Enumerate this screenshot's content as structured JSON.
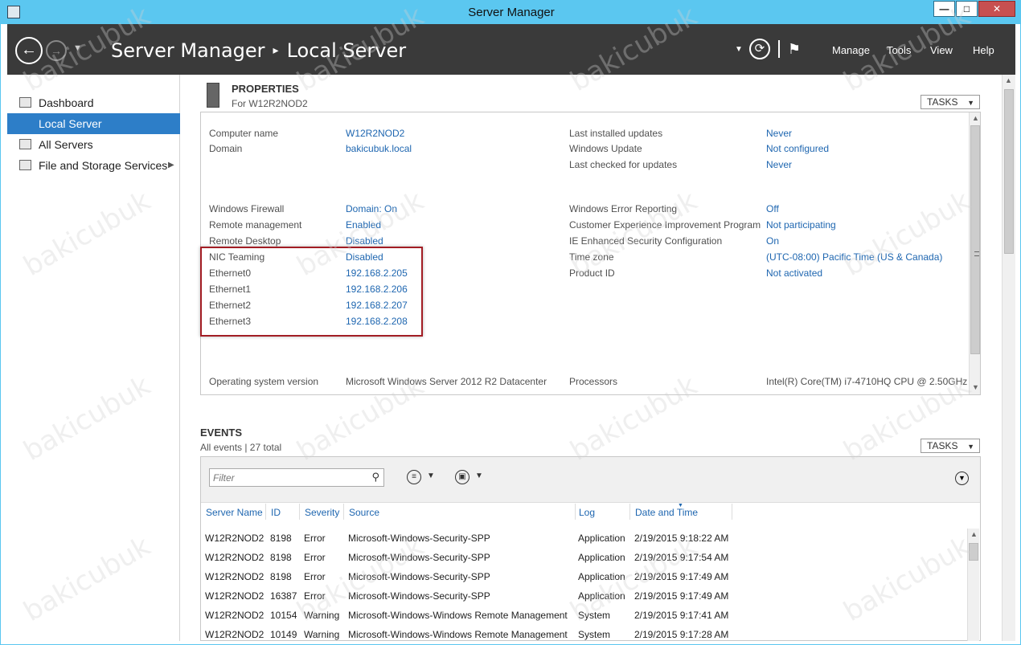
{
  "window": {
    "title": "Server Manager",
    "controls": {
      "minimize": "—",
      "maximize": "□",
      "close": "✕"
    }
  },
  "header": {
    "app": "Server Manager",
    "separator": "▸",
    "page": "Local Server",
    "menus": [
      "Manage",
      "Tools",
      "View",
      "Help"
    ]
  },
  "sidebar": {
    "items": [
      {
        "label": "Dashboard",
        "icon": "dashboard-icon",
        "active": false
      },
      {
        "label": "Local Server",
        "icon": "server-icon",
        "active": true
      },
      {
        "label": "All Servers",
        "icon": "servers-icon",
        "active": false
      },
      {
        "label": "File and Storage Services",
        "icon": "storage-icon",
        "active": false,
        "has_chevron": true
      }
    ]
  },
  "properties": {
    "title": "PROPERTIES",
    "subtitle": "For W12R2NOD2",
    "tasks": "TASKS",
    "left": [
      {
        "label": "Computer name",
        "value": "W12R2NOD2"
      },
      {
        "label": "Domain",
        "value": "bakicubuk.local"
      },
      {
        "label": "Windows Firewall",
        "value": "Domain: On"
      },
      {
        "label": "Remote management",
        "value": "Enabled"
      },
      {
        "label": "Remote Desktop",
        "value": "Disabled"
      },
      {
        "label": "NIC Teaming",
        "value": "Disabled"
      },
      {
        "label": "Ethernet0",
        "value": "192.168.2.205"
      },
      {
        "label": "Ethernet1",
        "value": "192.168.2.206"
      },
      {
        "label": "Ethernet2",
        "value": "192.168.2.207"
      },
      {
        "label": "Ethernet3",
        "value": "192.168.2.208"
      },
      {
        "label": "Operating system version",
        "value": "Microsoft Windows Server 2012 R2 Datacenter"
      }
    ],
    "right": [
      {
        "label": "Last installed updates",
        "value": "Never"
      },
      {
        "label": "Windows Update",
        "value": "Not configured"
      },
      {
        "label": "Last checked for updates",
        "value": "Never"
      },
      {
        "label": "Windows Error Reporting",
        "value": "Off"
      },
      {
        "label": "Customer Experience Improvement Program",
        "value": "Not participating"
      },
      {
        "label": "IE Enhanced Security Configuration",
        "value": "On"
      },
      {
        "label": "Time zone",
        "value": "(UTC-08:00) Pacific Time (US & Canada)"
      },
      {
        "label": "Product ID",
        "value": "Not activated"
      },
      {
        "label": "Processors",
        "value": "Intel(R) Core(TM) i7-4710HQ CPU @ 2.50GHz"
      }
    ]
  },
  "events": {
    "title": "EVENTS",
    "subtitle": "All events | 27 total",
    "tasks": "TASKS",
    "filter_placeholder": "Filter",
    "columns": [
      "Server Name",
      "ID",
      "Severity",
      "Source",
      "Log",
      "Date and Time"
    ],
    "rows": [
      [
        "W12R2NOD2",
        "8198",
        "Error",
        "Microsoft-Windows-Security-SPP",
        "Application",
        "2/19/2015 9:18:22 AM"
      ],
      [
        "W12R2NOD2",
        "8198",
        "Error",
        "Microsoft-Windows-Security-SPP",
        "Application",
        "2/19/2015 9:17:54 AM"
      ],
      [
        "W12R2NOD2",
        "8198",
        "Error",
        "Microsoft-Windows-Security-SPP",
        "Application",
        "2/19/2015 9:17:49 AM"
      ],
      [
        "W12R2NOD2",
        "16387",
        "Error",
        "Microsoft-Windows-Security-SPP",
        "Application",
        "2/19/2015 9:17:49 AM"
      ],
      [
        "W12R2NOD2",
        "10154",
        "Warning",
        "Microsoft-Windows-Windows Remote Management",
        "System",
        "2/19/2015 9:17:41 AM"
      ],
      [
        "W12R2NOD2",
        "10149",
        "Warning",
        "Microsoft-Windows-Windows Remote Management",
        "System",
        "2/19/2015 9:17:28 AM"
      ]
    ]
  },
  "watermark": "bakicubuk",
  "colors": {
    "accent": "#2d7ec8",
    "header_bg": "#3a3a3a",
    "titlebar": "#5bc7f0",
    "link": "#1e66b0",
    "highlight_border": "#a21d24"
  }
}
